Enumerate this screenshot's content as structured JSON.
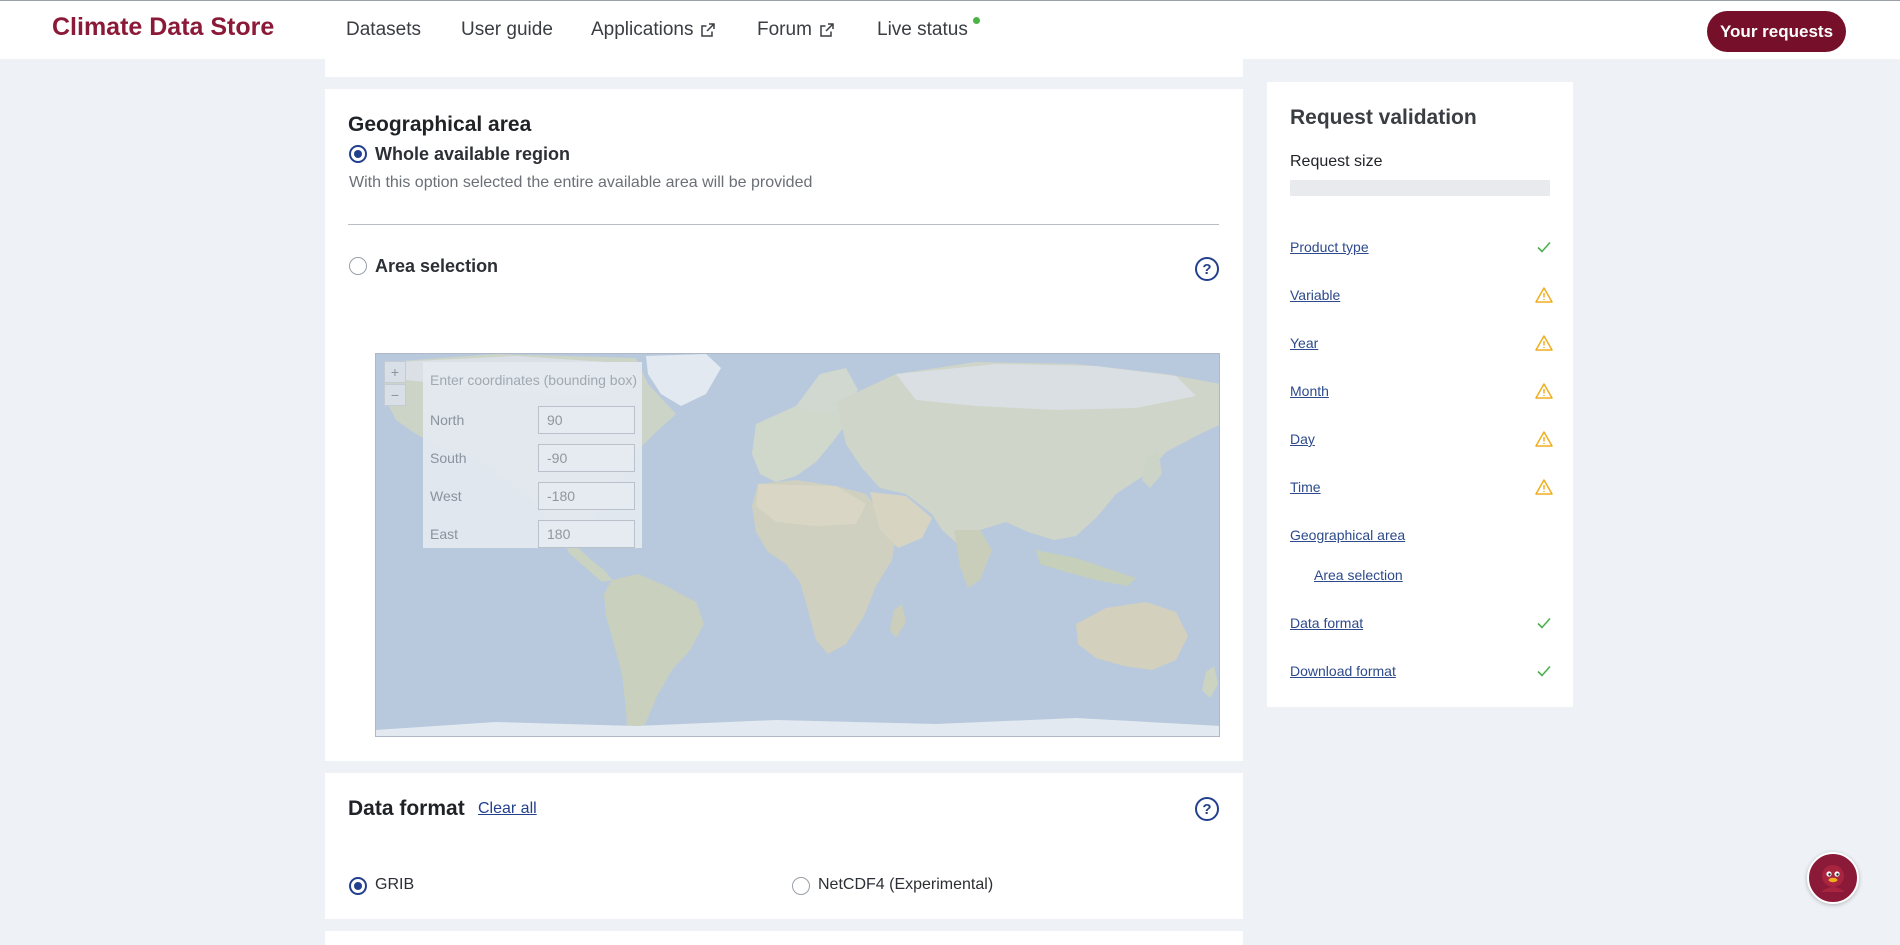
{
  "header": {
    "brand": "Climate Data Store",
    "nav": [
      {
        "label": "Datasets"
      },
      {
        "label": "User guide"
      },
      {
        "label": "Applications",
        "icon": "external-link-icon"
      },
      {
        "label": "Forum",
        "icon": "external-link-icon"
      },
      {
        "label": "Live status",
        "status_color": "#4bb543"
      }
    ],
    "requests_button": "Your requests"
  },
  "geo": {
    "title": "Geographical area",
    "whole": {
      "label": "Whole available region",
      "hint": "With this option selected the entire available area will be provided",
      "checked": true
    },
    "area": {
      "label": "Area selection",
      "checked": false
    },
    "map": {
      "zoom_in": "+",
      "zoom_out": "−",
      "panel_title": "Enter coordinates (bounding box)",
      "north": {
        "label": "North",
        "value": "90"
      },
      "south": {
        "label": "South",
        "value": "-90"
      },
      "west": {
        "label": "West",
        "value": "-180"
      },
      "east": {
        "label": "East",
        "value": "180"
      }
    }
  },
  "format": {
    "title": "Data format",
    "clear_all": "Clear all",
    "options": [
      {
        "label": "GRIB",
        "checked": true
      },
      {
        "label": "NetCDF4 (Experimental)",
        "checked": false
      }
    ]
  },
  "validation": {
    "title": "Request validation",
    "size_label": "Request size",
    "items": [
      {
        "label": "Product type",
        "status": "check-icon"
      },
      {
        "label": "Variable",
        "status": "warning-icon"
      },
      {
        "label": "Year",
        "status": "warning-icon"
      },
      {
        "label": "Month",
        "status": "warning-icon"
      },
      {
        "label": "Day",
        "status": "warning-icon"
      },
      {
        "label": "Time",
        "status": "warning-icon"
      },
      {
        "label": "Geographical area",
        "status": ""
      },
      {
        "label": "Area selection",
        "status": ""
      },
      {
        "label": "Data format",
        "status": "check-icon"
      },
      {
        "label": "Download format",
        "status": "check-icon"
      }
    ]
  },
  "colors": {
    "brand": "#8b1a38",
    "primary_button": "#76102a",
    "radio_accent": "#23408e",
    "check": "#4caf50",
    "warning": "#f0ad1e"
  }
}
